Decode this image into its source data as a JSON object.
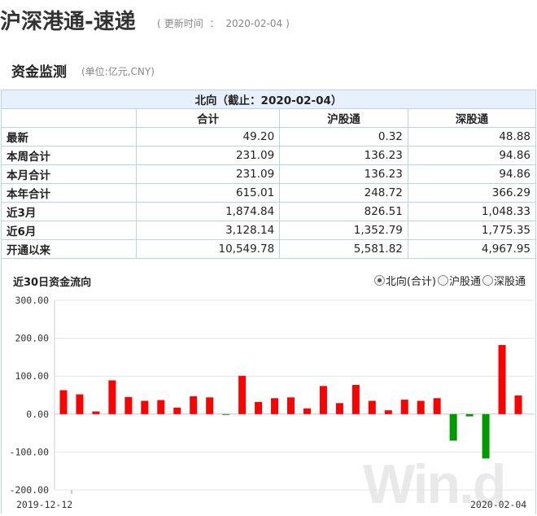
{
  "header": {
    "title": "沪深港通-速递",
    "update_label": "更新时间",
    "update_sep": "：",
    "update_date": "2020-02-04",
    "paren_open": "(",
    "paren_close": ")"
  },
  "section": {
    "title": "资金监测",
    "unit": "(单位:亿元,CNY)"
  },
  "table": {
    "caption": "北向（截止：2020-02-04）",
    "columns": [
      "合计",
      "沪股通",
      "深股通"
    ],
    "rows": [
      {
        "label": "最新",
        "values": [
          "49.20",
          "0.32",
          "48.88"
        ]
      },
      {
        "label": "本周合计",
        "values": [
          "231.09",
          "136.23",
          "94.86"
        ]
      },
      {
        "label": "本月合计",
        "values": [
          "231.09",
          "136.23",
          "94.86"
        ]
      },
      {
        "label": "本年合计",
        "values": [
          "615.01",
          "248.72",
          "366.29"
        ]
      },
      {
        "label": "近3月",
        "values": [
          "1,874.84",
          "826.51",
          "1,048.33"
        ]
      },
      {
        "label": "近6月",
        "values": [
          "3,128.14",
          "1,352.79",
          "1,775.35"
        ]
      },
      {
        "label": "开通以来",
        "values": [
          "10,549.78",
          "5,581.82",
          "4,967.95"
        ]
      }
    ]
  },
  "chart_section": {
    "title": "近30日资金流向",
    "options": [
      {
        "label": "北向(合计)",
        "selected": true
      },
      {
        "label": "沪股通",
        "selected": false
      },
      {
        "label": "深股通",
        "selected": false
      }
    ],
    "watermark": "Win.d"
  },
  "chart_data": {
    "type": "bar",
    "title": "",
    "xlabel": "",
    "ylabel": "",
    "ylim": [
      -200,
      300
    ],
    "yticks": [
      "300.00",
      "200.00",
      "100.00",
      "0.00",
      "-100.00",
      "-200.00"
    ],
    "ytick_values": [
      300,
      200,
      100,
      0,
      -100,
      -200
    ],
    "x_labels": [
      "2019-12-12",
      "2020-02-04"
    ],
    "grid": true,
    "positive_color": "#ff0000",
    "negative_color": "#009900",
    "values": [
      63,
      52,
      7,
      89,
      45,
      35,
      37,
      17,
      47,
      44,
      -2,
      101,
      32,
      42,
      44,
      15,
      74,
      29,
      77,
      35,
      10,
      38,
      35,
      42,
      -70,
      -6,
      -117,
      182,
      49.2
    ]
  }
}
